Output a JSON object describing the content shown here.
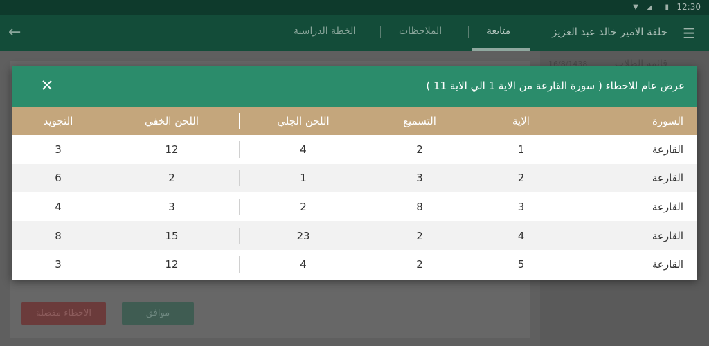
{
  "status_bar": {
    "time": "12:30",
    "icons": [
      "wifi-icon",
      "signal-icon",
      "battery-icon"
    ]
  },
  "toolbar": {
    "title": "حلقة الامير خالد عبد العزيز",
    "tabs": [
      {
        "label": "متابعة",
        "active": true
      },
      {
        "label": "الملاحظات",
        "active": false
      },
      {
        "label": "الخطة الدراسية",
        "active": false
      }
    ]
  },
  "background": {
    "list_title": "قائمة الطلاب",
    "list_date": "16/8/1438",
    "details_button": "الاخطاء مفصلة",
    "ok_button": "موافق"
  },
  "dialog": {
    "title": "عرض عام للاخطاء ( سورة القارعة من الاية 1 الي الاية 11 )",
    "columns": [
      "السورة",
      "الاية",
      "التسميع",
      "اللحن الجلي",
      "اللحن الخفي",
      "التجويد"
    ],
    "rows": [
      [
        "القارعة",
        "1",
        "2",
        "4",
        "12",
        "3"
      ],
      [
        "القارعة",
        "2",
        "3",
        "1",
        "2",
        "6"
      ],
      [
        "القارعة",
        "3",
        "8",
        "2",
        "3",
        "4"
      ],
      [
        "القارعة",
        "4",
        "2",
        "23",
        "15",
        "8"
      ],
      [
        "القارعة",
        "5",
        "2",
        "4",
        "12",
        "3"
      ]
    ]
  },
  "colors": {
    "header_green": "#2b8c6b",
    "table_header": "#c4a67c",
    "toolbar_green": "#134c39"
  }
}
